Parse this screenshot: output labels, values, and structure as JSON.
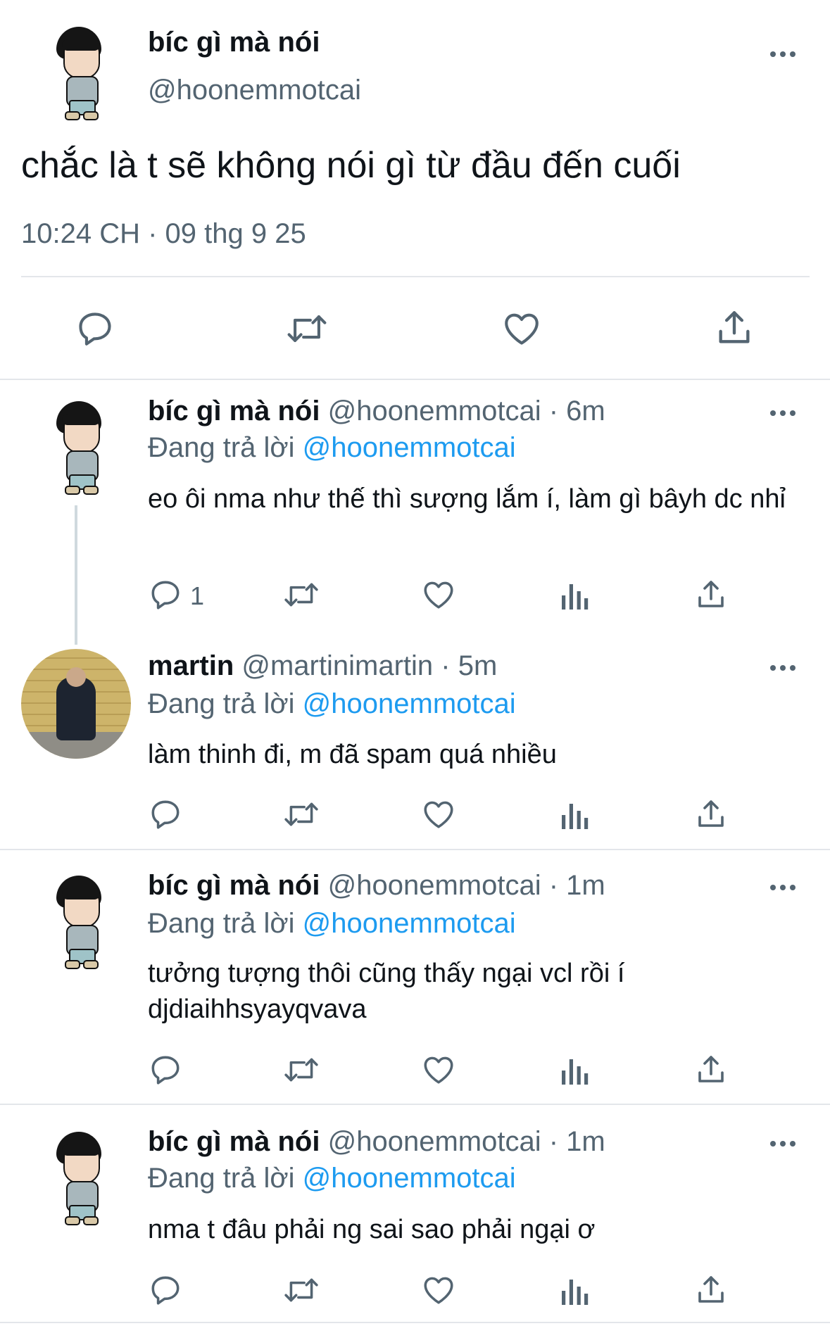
{
  "main_tweet": {
    "display_name": "bíc gì mà nói",
    "handle": "@hoonemmotcai",
    "text": "chắc là t sẽ không nói gì từ đầu đến cuối",
    "timestamp": "10:24 CH · 09 thg 9 25",
    "actions": [
      "reply-icon",
      "retweet-icon",
      "like-icon",
      "share-icon"
    ]
  },
  "replies": [
    {
      "display_name": "bíc gì mà nói",
      "handle": "@hoonemmotcai",
      "time": "· 6m",
      "replying_label": "Đang trả lời",
      "replying_to": "@hoonemmotcai",
      "text": "eo ôi nma như thế thì sượng lắm í, làm gì bâyh dc nhỉ",
      "reply_count": "1"
    },
    {
      "display_name": "martin",
      "handle": "@martinimartin",
      "time": "· 5m",
      "replying_label": "Đang trả lời",
      "replying_to": "@hoonemmotcai",
      "text": "làm thinh đi, m đã spam quá nhiều",
      "reply_count": ""
    },
    {
      "display_name": "bíc gì mà nói",
      "handle": "@hoonemmotcai",
      "time": "· 1m",
      "replying_label": "Đang trả lời",
      "replying_to": "@hoonemmotcai",
      "text": "tưởng tượng thôi cũng thấy ngại vcl rồi í djdiaihhsyayqvava",
      "reply_count": ""
    },
    {
      "display_name": "bíc gì mà nói",
      "handle": "@hoonemmotcai",
      "time": "· 1m",
      "replying_label": "Đang trả lời",
      "replying_to": "@hoonemmotcai",
      "text": "nma t đâu phải ng sai sao phải ngại ơ",
      "reply_count": ""
    }
  ],
  "colors": {
    "accent": "#1d9bf0",
    "secondary_text": "#536471",
    "text": "#0f1419",
    "divider": "#e3e6ea"
  }
}
